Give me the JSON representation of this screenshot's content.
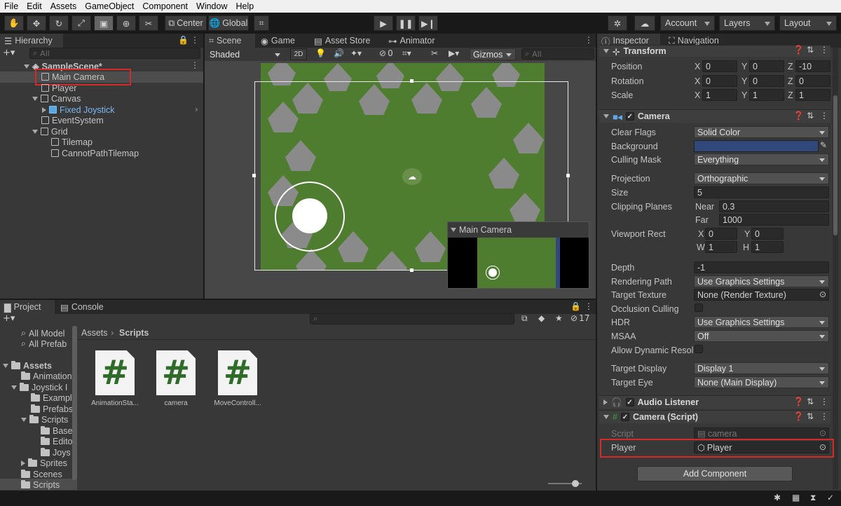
{
  "menu": [
    "File",
    "Edit",
    "Assets",
    "GameObject",
    "Component",
    "Window",
    "Help"
  ],
  "toolbar": {
    "pivot_label": "Center",
    "space_label": "Global",
    "account_label": "Account",
    "layers_label": "Layers",
    "layout_label": "Layout"
  },
  "hierarchy": {
    "tab_label": "Hierarchy",
    "search_placeholder": "All",
    "scene_name": "SampleScene*",
    "items": [
      {
        "label": "Main Camera"
      },
      {
        "label": "Player"
      },
      {
        "label": "Canvas"
      },
      {
        "label": "Fixed Joystick"
      },
      {
        "label": "EventSystem"
      },
      {
        "label": "Grid"
      },
      {
        "label": "Tilemap"
      },
      {
        "label": "CannotPathTilemap"
      }
    ]
  },
  "scene": {
    "tabs": [
      "Scene",
      "Game",
      "Asset Store",
      "Animator"
    ],
    "shading_mode": "Shaded",
    "mode_2d": "2D",
    "hidden_count": "0",
    "gizmos_label": "Gizmos",
    "search_placeholder": "All",
    "camera_preview_title": "Main Camera"
  },
  "project": {
    "tabs": [
      "Project",
      "Console"
    ],
    "favorites": [
      "All Model",
      "All Prefab"
    ],
    "tree": [
      "Assets",
      "Animation",
      "Joystick I",
      "Exampl",
      "Prefabs",
      "Scripts",
      "Base",
      "Edito",
      "Joys",
      "Sprites",
      "Scenes",
      "Scripts"
    ],
    "breadcrumb_root": "Assets",
    "breadcrumb_current": "Scripts",
    "hidden_count": "17",
    "assets": [
      {
        "name": "AnimationSta..."
      },
      {
        "name": "camera"
      },
      {
        "name": "MoveControll..."
      }
    ]
  },
  "inspector": {
    "tabs": [
      "Inspector",
      "Navigation"
    ],
    "transform": {
      "title": "Transform",
      "position_label": "Position",
      "rotation_label": "Rotation",
      "scale_label": "Scale",
      "axis_x": "X",
      "axis_y": "Y",
      "axis_z": "Z",
      "position": [
        "0",
        "0",
        "-10"
      ],
      "rotation": [
        "0",
        "0",
        "0"
      ],
      "scale": [
        "1",
        "1",
        "1"
      ]
    },
    "camera": {
      "title": "Camera",
      "clear_flags_label": "Clear Flags",
      "clear_flags": "Solid Color",
      "background_label": "Background",
      "background_color": "#31497a",
      "culling_mask_label": "Culling Mask",
      "culling_mask": "Everything",
      "projection_label": "Projection",
      "projection": "Orthographic",
      "size_label": "Size",
      "size": "5",
      "clipping_label": "Clipping Planes",
      "near_label": "Near",
      "near": "0.3",
      "far_label": "Far",
      "far": "1000",
      "viewport_label": "Viewport Rect",
      "vx_label": "X",
      "vx": "0",
      "vy_label": "Y",
      "vy": "0",
      "vw_label": "W",
      "vw": "1",
      "vh_label": "H",
      "vh": "1",
      "depth_label": "Depth",
      "depth": "-1",
      "rendering_path_label": "Rendering Path",
      "rendering_path": "Use Graphics Settings",
      "target_texture_label": "Target Texture",
      "target_texture": "None (Render Texture)",
      "occlusion_label": "Occlusion Culling",
      "hdr_label": "HDR",
      "hdr": "Use Graphics Settings",
      "msaa_label": "MSAA",
      "msaa": "Off",
      "dyn_res_label": "Allow Dynamic Resol",
      "target_display_label": "Target Display",
      "target_display": "Display 1",
      "target_eye_label": "Target Eye",
      "target_eye": "None (Main Display)"
    },
    "audio_listener": {
      "title": "Audio Listener"
    },
    "camera_script": {
      "title": "Camera (Script)",
      "script_label": "Script",
      "script_value": "camera",
      "player_label": "Player",
      "player_value": "Player"
    },
    "add_component_label": "Add Component"
  },
  "colors": {
    "highlight": "#d42a2a",
    "grass": "#4f7d2f",
    "selection": "#4d4d4d"
  }
}
